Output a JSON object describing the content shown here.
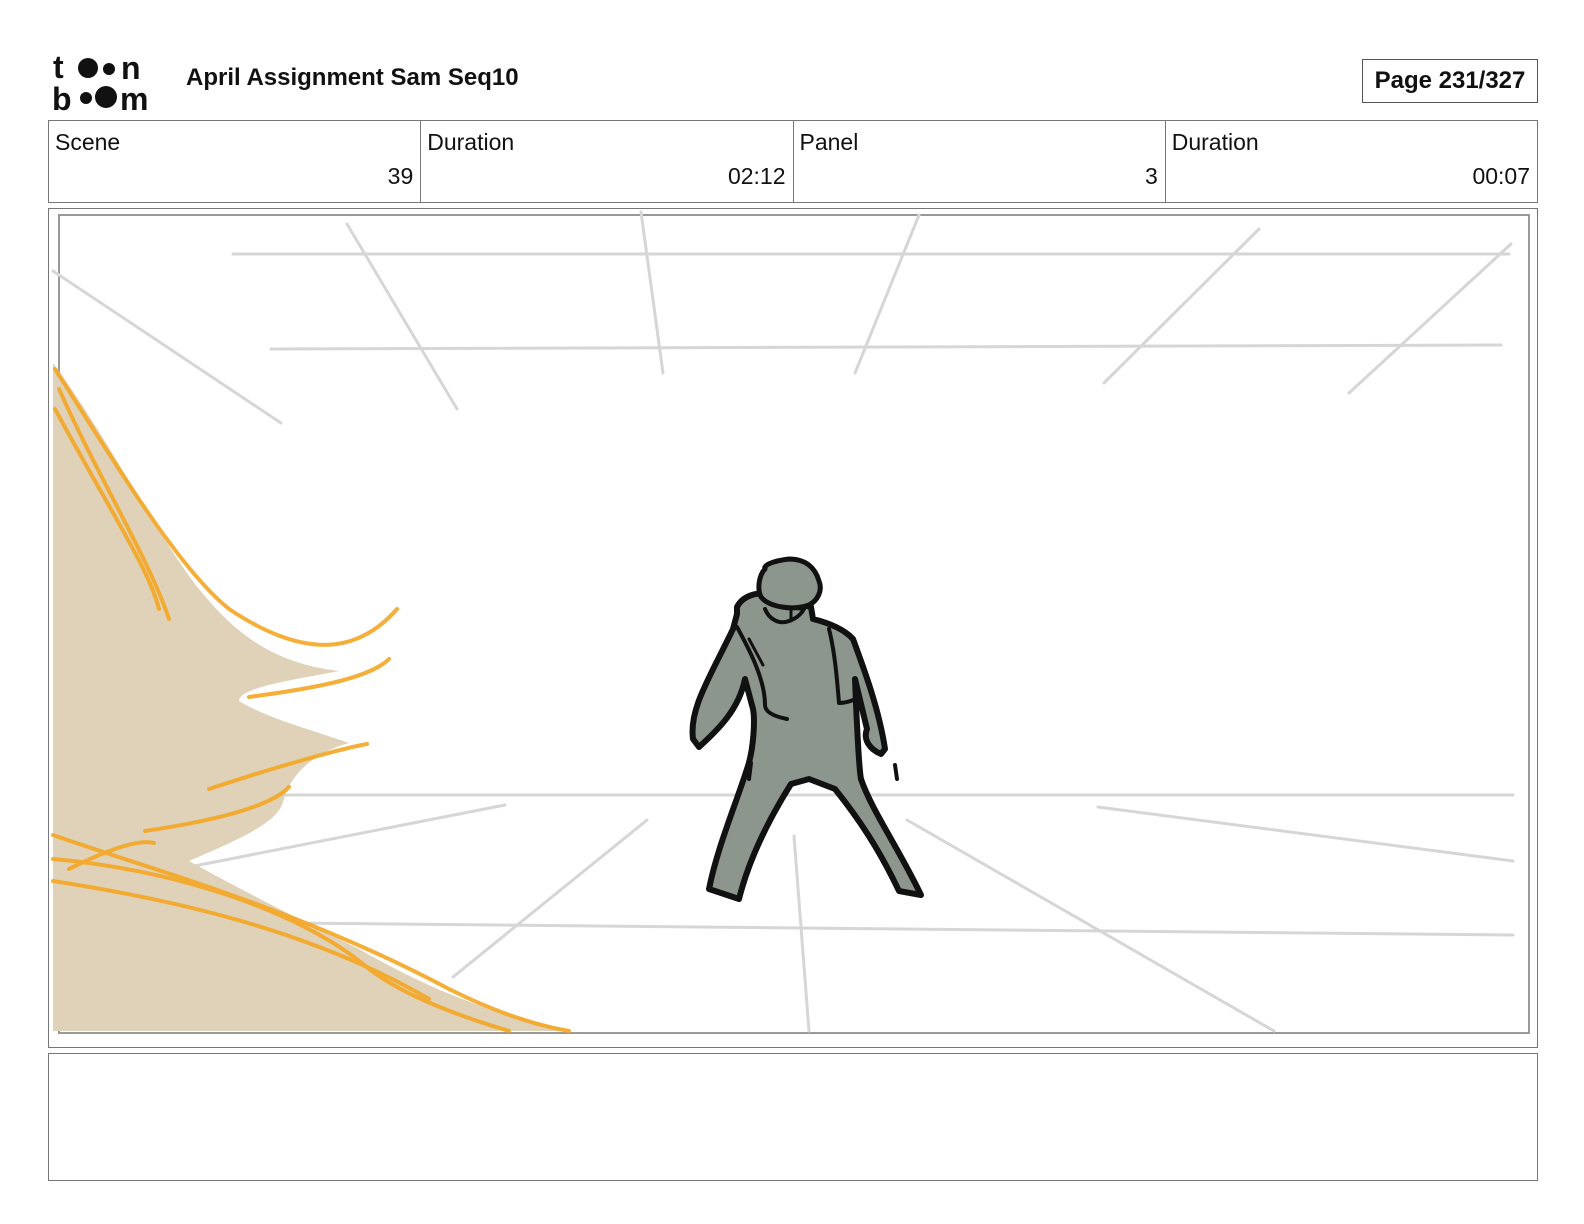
{
  "header": {
    "logo_text": "toon boom",
    "title": "April Assignment Sam Seq10",
    "page_label": "Page 231/327"
  },
  "info": {
    "scene_label": "Scene",
    "scene_value": "39",
    "scene_duration_label": "Duration",
    "scene_duration_value": "02:12",
    "panel_label": "Panel",
    "panel_value": "3",
    "panel_duration_label": "Duration",
    "panel_duration_value": "00:07"
  },
  "colors": {
    "sketch_lines": "#d6d6d6",
    "foreground_fill": "#dfd2b8",
    "foreground_strokes": "#f5a623",
    "figure_fill": "#8c968c",
    "figure_outline": "#111111"
  },
  "notes": {
    "text": ""
  }
}
